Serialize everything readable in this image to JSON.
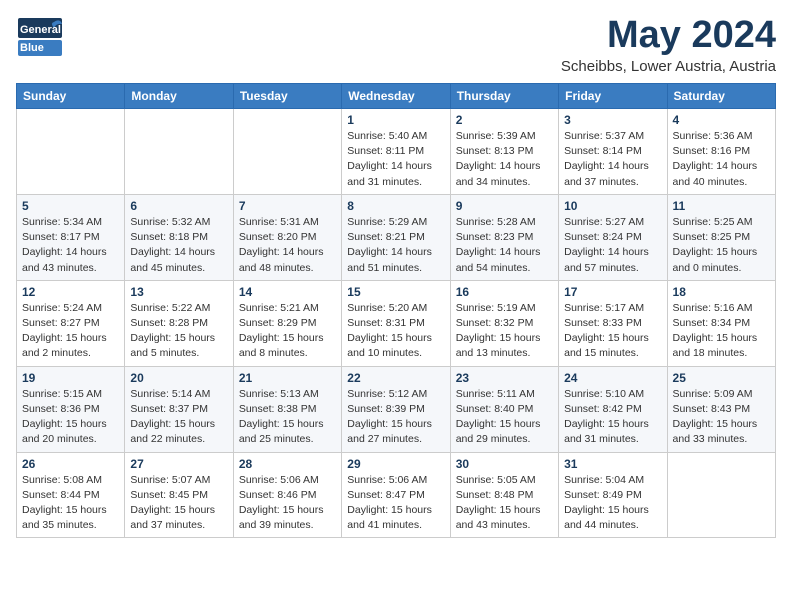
{
  "header": {
    "logo_general": "General",
    "logo_blue": "Blue",
    "title": "May 2024",
    "location": "Scheibbs, Lower Austria, Austria"
  },
  "days_of_week": [
    "Sunday",
    "Monday",
    "Tuesday",
    "Wednesday",
    "Thursday",
    "Friday",
    "Saturday"
  ],
  "weeks": [
    [
      {
        "day": "",
        "info": ""
      },
      {
        "day": "",
        "info": ""
      },
      {
        "day": "",
        "info": ""
      },
      {
        "day": "1",
        "info": "Sunrise: 5:40 AM\nSunset: 8:11 PM\nDaylight: 14 hours\nand 31 minutes."
      },
      {
        "day": "2",
        "info": "Sunrise: 5:39 AM\nSunset: 8:13 PM\nDaylight: 14 hours\nand 34 minutes."
      },
      {
        "day": "3",
        "info": "Sunrise: 5:37 AM\nSunset: 8:14 PM\nDaylight: 14 hours\nand 37 minutes."
      },
      {
        "day": "4",
        "info": "Sunrise: 5:36 AM\nSunset: 8:16 PM\nDaylight: 14 hours\nand 40 minutes."
      }
    ],
    [
      {
        "day": "5",
        "info": "Sunrise: 5:34 AM\nSunset: 8:17 PM\nDaylight: 14 hours\nand 43 minutes."
      },
      {
        "day": "6",
        "info": "Sunrise: 5:32 AM\nSunset: 8:18 PM\nDaylight: 14 hours\nand 45 minutes."
      },
      {
        "day": "7",
        "info": "Sunrise: 5:31 AM\nSunset: 8:20 PM\nDaylight: 14 hours\nand 48 minutes."
      },
      {
        "day": "8",
        "info": "Sunrise: 5:29 AM\nSunset: 8:21 PM\nDaylight: 14 hours\nand 51 minutes."
      },
      {
        "day": "9",
        "info": "Sunrise: 5:28 AM\nSunset: 8:23 PM\nDaylight: 14 hours\nand 54 minutes."
      },
      {
        "day": "10",
        "info": "Sunrise: 5:27 AM\nSunset: 8:24 PM\nDaylight: 14 hours\nand 57 minutes."
      },
      {
        "day": "11",
        "info": "Sunrise: 5:25 AM\nSunset: 8:25 PM\nDaylight: 15 hours\nand 0 minutes."
      }
    ],
    [
      {
        "day": "12",
        "info": "Sunrise: 5:24 AM\nSunset: 8:27 PM\nDaylight: 15 hours\nand 2 minutes."
      },
      {
        "day": "13",
        "info": "Sunrise: 5:22 AM\nSunset: 8:28 PM\nDaylight: 15 hours\nand 5 minutes."
      },
      {
        "day": "14",
        "info": "Sunrise: 5:21 AM\nSunset: 8:29 PM\nDaylight: 15 hours\nand 8 minutes."
      },
      {
        "day": "15",
        "info": "Sunrise: 5:20 AM\nSunset: 8:31 PM\nDaylight: 15 hours\nand 10 minutes."
      },
      {
        "day": "16",
        "info": "Sunrise: 5:19 AM\nSunset: 8:32 PM\nDaylight: 15 hours\nand 13 minutes."
      },
      {
        "day": "17",
        "info": "Sunrise: 5:17 AM\nSunset: 8:33 PM\nDaylight: 15 hours\nand 15 minutes."
      },
      {
        "day": "18",
        "info": "Sunrise: 5:16 AM\nSunset: 8:34 PM\nDaylight: 15 hours\nand 18 minutes."
      }
    ],
    [
      {
        "day": "19",
        "info": "Sunrise: 5:15 AM\nSunset: 8:36 PM\nDaylight: 15 hours\nand 20 minutes."
      },
      {
        "day": "20",
        "info": "Sunrise: 5:14 AM\nSunset: 8:37 PM\nDaylight: 15 hours\nand 22 minutes."
      },
      {
        "day": "21",
        "info": "Sunrise: 5:13 AM\nSunset: 8:38 PM\nDaylight: 15 hours\nand 25 minutes."
      },
      {
        "day": "22",
        "info": "Sunrise: 5:12 AM\nSunset: 8:39 PM\nDaylight: 15 hours\nand 27 minutes."
      },
      {
        "day": "23",
        "info": "Sunrise: 5:11 AM\nSunset: 8:40 PM\nDaylight: 15 hours\nand 29 minutes."
      },
      {
        "day": "24",
        "info": "Sunrise: 5:10 AM\nSunset: 8:42 PM\nDaylight: 15 hours\nand 31 minutes."
      },
      {
        "day": "25",
        "info": "Sunrise: 5:09 AM\nSunset: 8:43 PM\nDaylight: 15 hours\nand 33 minutes."
      }
    ],
    [
      {
        "day": "26",
        "info": "Sunrise: 5:08 AM\nSunset: 8:44 PM\nDaylight: 15 hours\nand 35 minutes."
      },
      {
        "day": "27",
        "info": "Sunrise: 5:07 AM\nSunset: 8:45 PM\nDaylight: 15 hours\nand 37 minutes."
      },
      {
        "day": "28",
        "info": "Sunrise: 5:06 AM\nSunset: 8:46 PM\nDaylight: 15 hours\nand 39 minutes."
      },
      {
        "day": "29",
        "info": "Sunrise: 5:06 AM\nSunset: 8:47 PM\nDaylight: 15 hours\nand 41 minutes."
      },
      {
        "day": "30",
        "info": "Sunrise: 5:05 AM\nSunset: 8:48 PM\nDaylight: 15 hours\nand 43 minutes."
      },
      {
        "day": "31",
        "info": "Sunrise: 5:04 AM\nSunset: 8:49 PM\nDaylight: 15 hours\nand 44 minutes."
      },
      {
        "day": "",
        "info": ""
      }
    ]
  ]
}
